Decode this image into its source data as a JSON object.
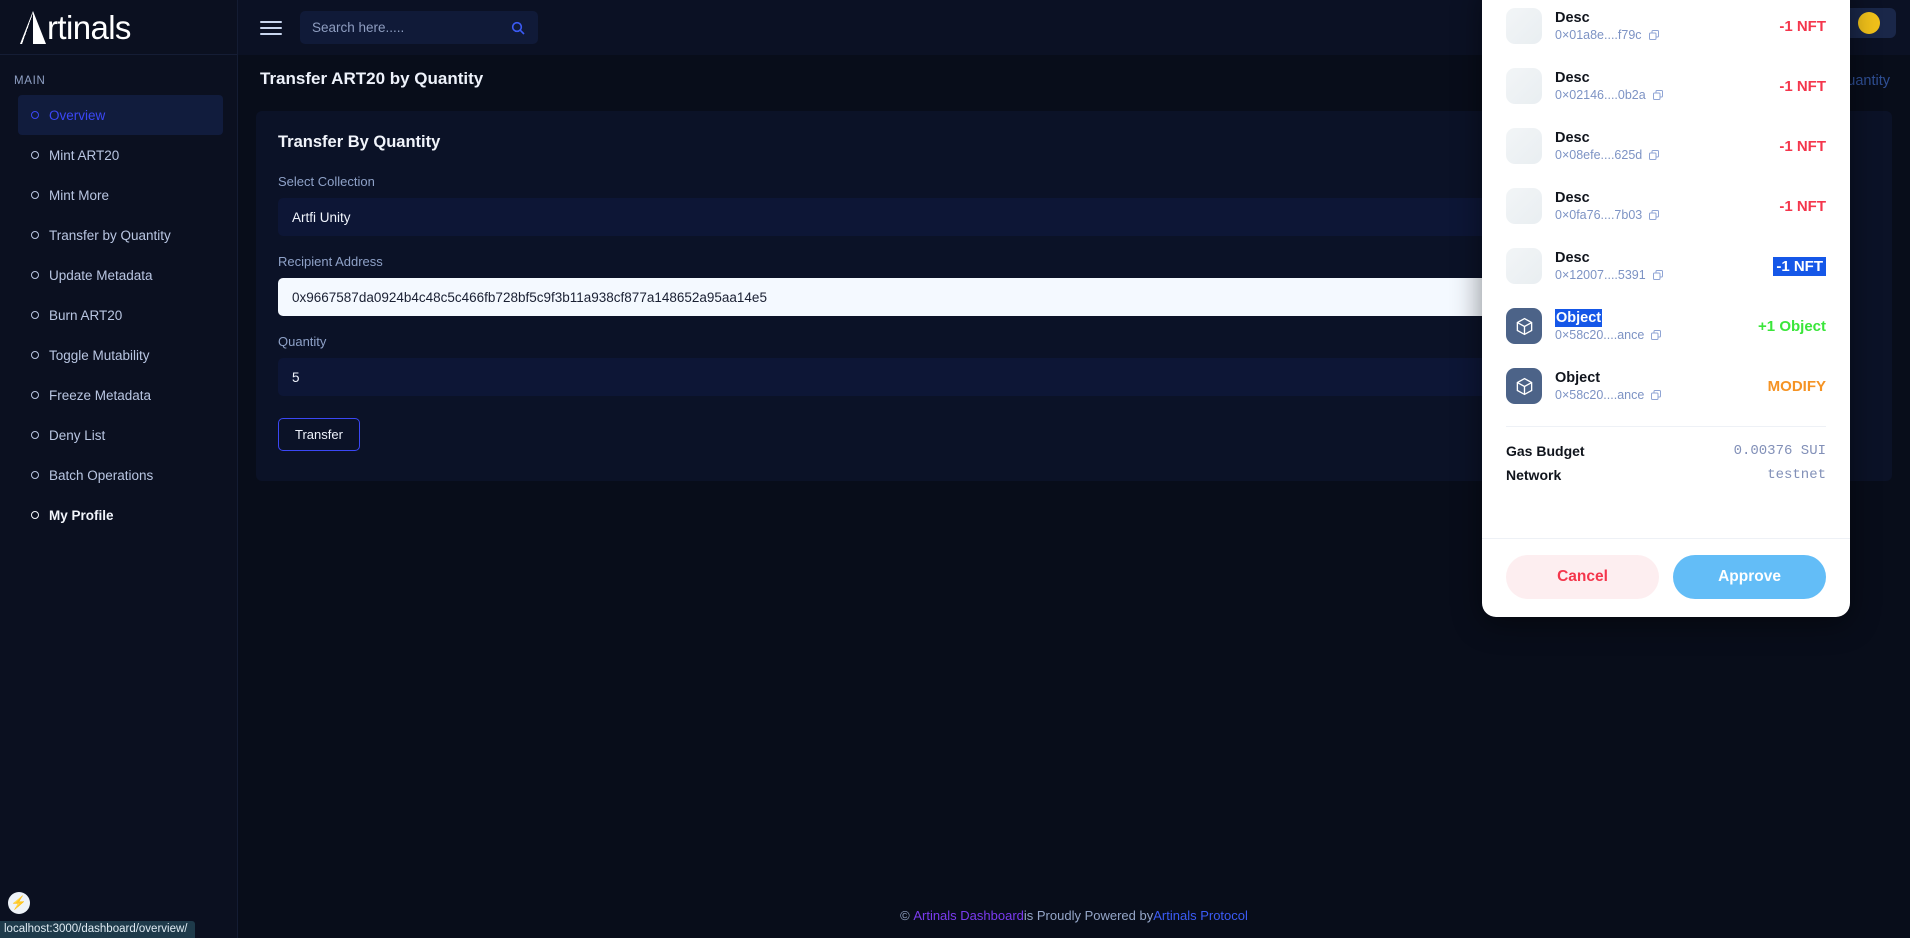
{
  "brand": {
    "name": "Artinals"
  },
  "sidebar": {
    "section_label": "MAIN",
    "items": [
      {
        "label": "Overview",
        "icon": "circle-icon",
        "active": true,
        "bold": false
      },
      {
        "label": "Mint ART20",
        "icon": "circle-icon",
        "active": false,
        "bold": false
      },
      {
        "label": "Mint More",
        "icon": "circle-icon",
        "active": false,
        "bold": false
      },
      {
        "label": "Transfer by Quantity",
        "icon": "circle-icon",
        "active": false,
        "bold": false
      },
      {
        "label": "Update Metadata",
        "icon": "circle-icon",
        "active": false,
        "bold": false
      },
      {
        "label": "Burn ART20",
        "icon": "circle-icon",
        "active": false,
        "bold": false
      },
      {
        "label": "Toggle Mutability",
        "icon": "circle-icon",
        "active": false,
        "bold": false
      },
      {
        "label": "Freeze Metadata",
        "icon": "circle-icon",
        "active": false,
        "bold": false
      },
      {
        "label": "Deny List",
        "icon": "circle-icon",
        "active": false,
        "bold": false
      },
      {
        "label": "Batch Operations",
        "icon": "circle-icon",
        "active": false,
        "bold": false
      },
      {
        "label": "My Profile",
        "icon": "circle-icon",
        "active": false,
        "bold": true
      }
    ]
  },
  "header": {
    "menu_icon": "hamburger-icon",
    "search": {
      "placeholder": "Search here.....",
      "value": "",
      "icon": "search-icon"
    },
    "wallet_icon": "wallet-coin-icon"
  },
  "main": {
    "page_title": "Transfer ART20 by Quantity",
    "right_label": "Quantity",
    "card": {
      "heading": "Transfer By Quantity",
      "fields": [
        {
          "label": "Select Collection",
          "value": "Artfi Unity",
          "kind": "select"
        },
        {
          "label": "Recipient Address",
          "value": "0x9667587da0924b4c48c5c466fb728bf5c9f3b11a938cf877a148652a95aa14e5",
          "kind": "light"
        },
        {
          "label": "Quantity",
          "value": "5",
          "kind": "qty"
        }
      ],
      "submit_label": "Transfer"
    }
  },
  "footer": {
    "copyright_symbol": "©",
    "brand_link": "Artinals Dashboard",
    "middle_text": " is Proudly Powered by ",
    "protocol_link": "Artinals Protocol"
  },
  "statusbar": {
    "url": "localhost:3000/dashboard/overview/",
    "badge_icon": "lightning-bolt-icon"
  },
  "modal": {
    "assets": [
      {
        "title": "Desc",
        "address": "0×01a8e....f79c",
        "delta": "-1 NFT",
        "delta_color": "#f4364c",
        "icon": "image-thumb-icon",
        "title_selected": false,
        "delta_selected": false
      },
      {
        "title": "Desc",
        "address": "0×02146....0b2a",
        "delta": "-1 NFT",
        "delta_color": "#f4364c",
        "icon": "image-thumb-icon",
        "title_selected": false,
        "delta_selected": false
      },
      {
        "title": "Desc",
        "address": "0×08efe....625d",
        "delta": "-1 NFT",
        "delta_color": "#f4364c",
        "icon": "image-thumb-icon",
        "title_selected": false,
        "delta_selected": false
      },
      {
        "title": "Desc",
        "address": "0×0fa76....7b03",
        "delta": "-1 NFT",
        "delta_color": "#f4364c",
        "icon": "image-thumb-icon",
        "title_selected": false,
        "delta_selected": false
      },
      {
        "title": "Desc",
        "address": "0×12007....5391",
        "delta": "-1 NFT",
        "delta_color": "#f4364c",
        "icon": "image-thumb-icon",
        "title_selected": false,
        "delta_selected": true
      },
      {
        "title": "Object",
        "address": "0×58c20....ance",
        "delta": "+1 Object",
        "delta_color": "#3ae63a",
        "icon": "cube-object-icon",
        "title_selected": true,
        "delta_selected": false
      },
      {
        "title": "Object",
        "address": "0×58c20....ance",
        "delta": "MODIFY",
        "delta_color": "#f59324",
        "icon": "cube-object-icon",
        "title_selected": false,
        "delta_selected": false
      }
    ],
    "summary": [
      {
        "key": "Gas Budget",
        "value": "0.00376 SUI"
      },
      {
        "key": "Network",
        "value": "testnet"
      }
    ],
    "cancel_label": "Cancel",
    "approve_label": "Approve",
    "copy_icon": "copy-icon"
  },
  "colors": {
    "accent_blue": "#3b47f5",
    "negative": "#f4364c",
    "positive": "#3ae63a",
    "modify": "#f59324",
    "selection": "#1557e8",
    "approve": "#63bdf7",
    "wallet_coin": "#f2c21a"
  }
}
